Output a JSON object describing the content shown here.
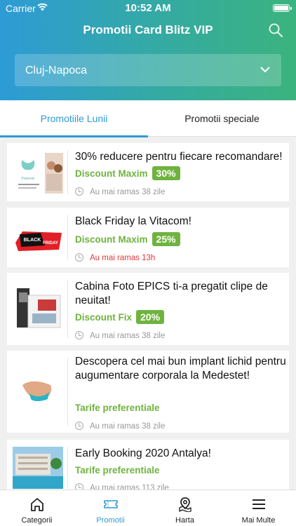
{
  "status": {
    "carrier": "Carrier",
    "time": "10:52 AM"
  },
  "header": {
    "title": "Promotii Card Blitz VIP",
    "icons": {
      "search": "search-icon",
      "dropdown": "chevron-down-icon"
    }
  },
  "city": {
    "value": "Cluj-Napoca"
  },
  "tabs": [
    {
      "label": "Promotiile Lunii",
      "active": true
    },
    {
      "label": "Promotii speciale",
      "active": false
    }
  ],
  "cards": [
    {
      "title": "30% reducere pentru fiecare recomandare!",
      "tag": "Discount Maxim",
      "badge": "30%",
      "time": "Au mai ramas 38 zile",
      "urgent": false
    },
    {
      "title": "Black Friday la Vitacom!",
      "tag": "Discount Maxim",
      "badge": "25%",
      "time": "Au mai ramas 13h",
      "urgent": true
    },
    {
      "title": "Cabina Foto EPICS ti-a pregatit clipe de neuitat!",
      "tag": "Discount Fix",
      "badge": "20%",
      "time": "Au mai ramas 38 zile",
      "urgent": false
    },
    {
      "title": "Descopera cel mai bun implant lichid pentru augumentare corporala la Medestet!",
      "tag": "Tarife preferentiale",
      "badge": null,
      "time": "Au mai ramas 38 zile",
      "urgent": false
    },
    {
      "title": "Early Booking 2020 Antalya!",
      "tag": "Tarife preferentiale",
      "badge": null,
      "time": "Au mai ramas 113 zile",
      "urgent": false
    }
  ],
  "nav": [
    {
      "label": "Categorii",
      "icon": "home-icon",
      "active": false
    },
    {
      "label": "Promotii",
      "icon": "ticket-icon",
      "active": true
    },
    {
      "label": "Harta",
      "icon": "map-icon",
      "active": false
    },
    {
      "label": "Mai Multe",
      "icon": "menu-icon",
      "active": false
    }
  ],
  "colors": {
    "accent": "#2d9bd6",
    "green": "#6fb33f",
    "urgent": "#e03a3a"
  }
}
